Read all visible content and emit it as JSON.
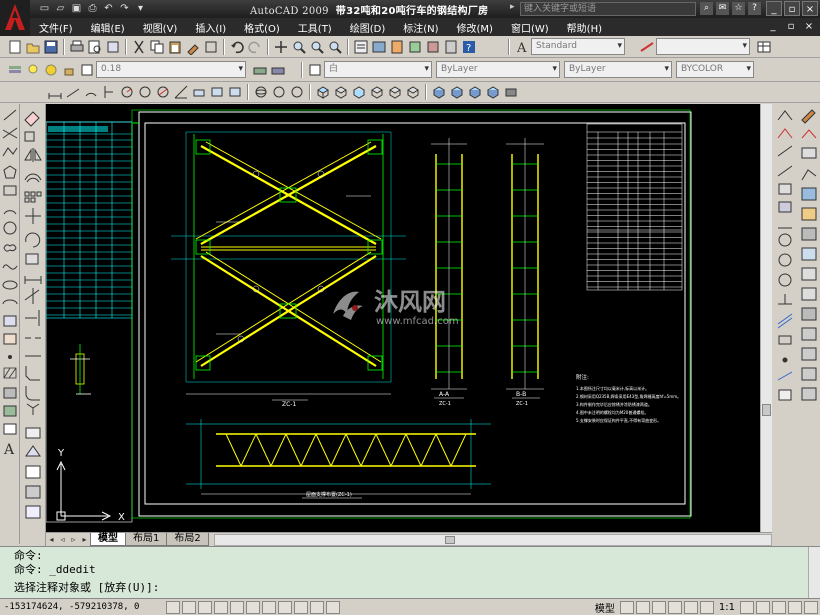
{
  "app": {
    "title_prefix": "AutoCAD 2009",
    "title_doc": "带32吨和20吨行车的钢结构厂房",
    "search_placeholder": "键入关键字或短语"
  },
  "menu": [
    "文件(F)",
    "编辑(E)",
    "视图(V)",
    "插入(I)",
    "格式(O)",
    "工具(T)",
    "绘图(D)",
    "标注(N)",
    "修改(M)",
    "窗口(W)",
    "帮助(H)"
  ],
  "toolbar": {
    "text_style": "Standard",
    "layer_value": "0.18",
    "color_value": "白",
    "linetype_value": "ByLayer",
    "lineweight_value": "ByLayer",
    "plotstyle_value": "BYCOLOR"
  },
  "drawing": {
    "elev_label": "ZC-1",
    "section_a": "A-A",
    "section_a_sub": "ZC-1",
    "section_b": "B-B",
    "section_b_sub": "ZC-1",
    "bottom_label": "屋面支撑布置(ZC-1)",
    "watermark_cn": "沐风网",
    "watermark_en": "www.mfcad.com",
    "notes_title": "附注:",
    "notes": [
      "1.本图所注尺寸均以毫米计,标高以米计。",
      "2.钢材采用Q235B,焊条采用E43型,角焊缝高度hf=5mm。",
      "3.构件制作完毕后应除锈并涂防锈漆两道。",
      "4.图中未注明的螺栓均为M20普通螺栓。",
      "5.支撑安装时应保证构件平直,不得有弯曲变形。"
    ]
  },
  "tabs": [
    "模型",
    "布局1",
    "布局2"
  ],
  "command": {
    "line1": "命令:",
    "line2": "命令: _ddedit",
    "line3": "选择注释对象或 [放弃(U)]:"
  },
  "status": {
    "coords": "-153174624, -579210378, 0",
    "model": "模型",
    "scale": "1:1"
  },
  "ucs": {
    "x": "X",
    "y": "Y"
  },
  "colors": {
    "drawing_yellow": "#ffff00",
    "drawing_green": "#00ff00",
    "drawing_cyan": "#00ffff",
    "drawing_white": "#ffffff",
    "command_bg": "#d8e8d8"
  }
}
